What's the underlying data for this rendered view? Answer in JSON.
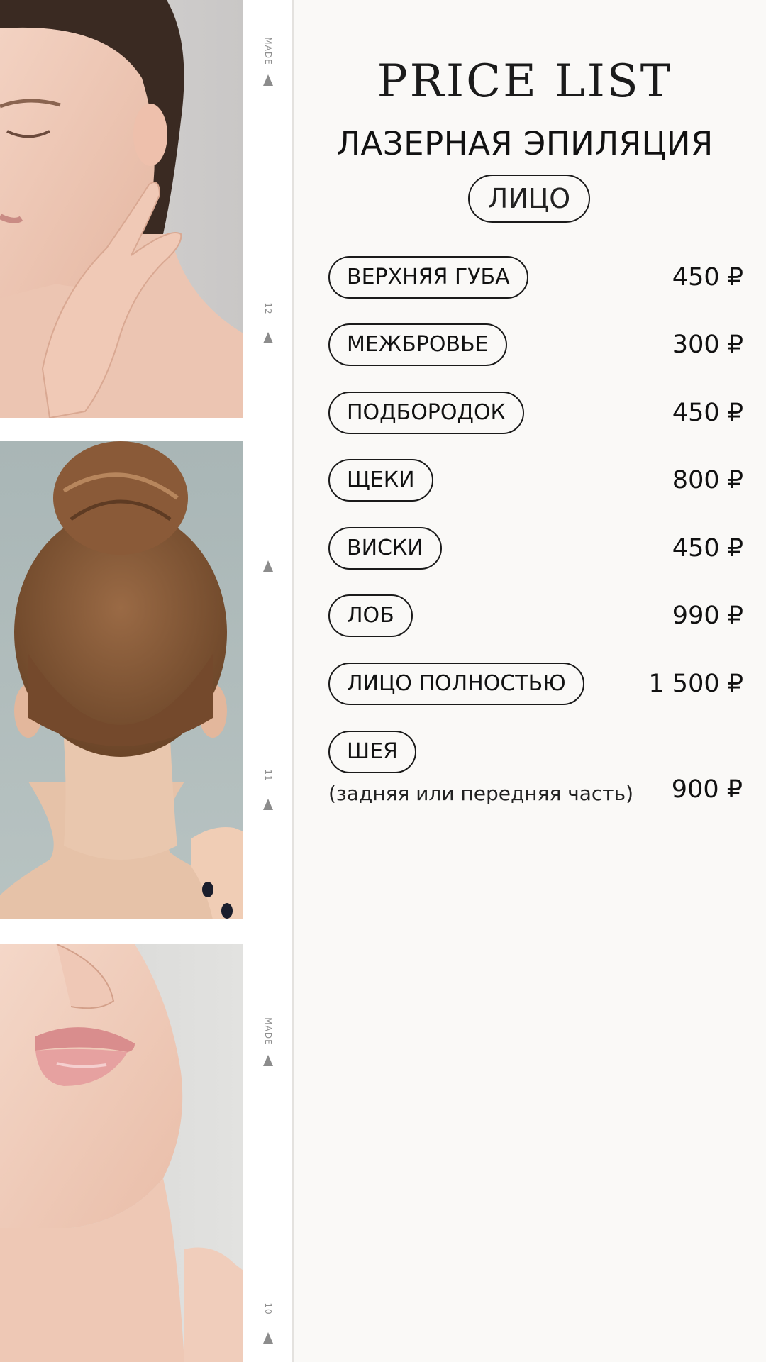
{
  "header": {
    "title": "PRICE LIST",
    "subtitle": "ЛАЗЕРНАЯ ЭПИЛЯЦИЯ",
    "category": "ЛИЦО"
  },
  "film_strip": {
    "marks": [
      "MADE",
      "12",
      "11",
      "MADE",
      "10"
    ]
  },
  "services": [
    {
      "name": "ВЕРХНЯЯ ГУБА",
      "price": "450 ₽"
    },
    {
      "name": "МЕЖБРОВЬЕ",
      "price": "300 ₽"
    },
    {
      "name": "ПОДБОРОДОК",
      "price": "450 ₽"
    },
    {
      "name": "ЩЕКИ",
      "price": "800 ₽"
    },
    {
      "name": "ВИСКИ",
      "price": "450 ₽"
    },
    {
      "name": "ЛОБ",
      "price": "990 ₽"
    },
    {
      "name": "ЛИЦО ПОЛНОСТЬЮ",
      "price": "1 500 ₽"
    },
    {
      "name": "ШЕЯ",
      "note": "(задняя или передняя часть)",
      "price": "900 ₽"
    }
  ],
  "colors": {
    "background": "#faf9f7",
    "text": "#111111",
    "film_mark": "#8c8c8c"
  }
}
